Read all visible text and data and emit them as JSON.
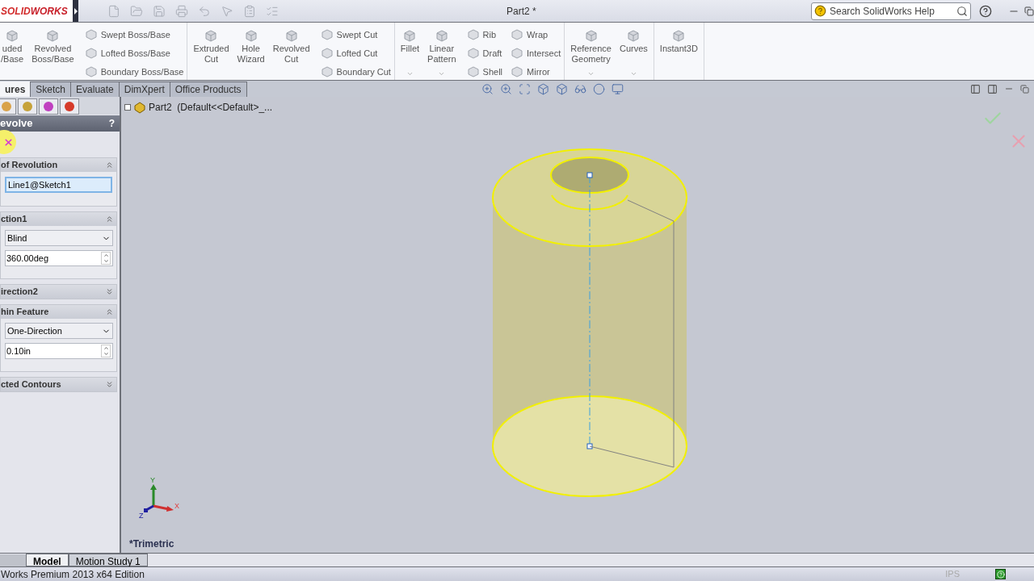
{
  "title_bar": {
    "logo": {
      "first": "SOLID",
      "second": "WORKS"
    },
    "title": "Part2 *",
    "search": {
      "placeholder": "Search SolidWorks Help"
    }
  },
  "ribbon": {
    "groups": [
      {
        "large": [
          {
            "lines": [
              "uded",
              "/Base"
            ]
          },
          {
            "lines": [
              "Revolved",
              "Boss/Base"
            ]
          }
        ],
        "small": [
          [
            "Swept Boss/Base",
            "Lofted Boss/Base",
            "Boundary Boss/Base"
          ]
        ]
      },
      {
        "large": [
          {
            "lines": [
              "Extruded",
              "Cut"
            ]
          },
          {
            "lines": [
              "Hole",
              "Wizard"
            ]
          },
          {
            "lines": [
              "Revolved",
              "Cut"
            ]
          }
        ],
        "small": [
          [
            "Swept Cut",
            "Lofted Cut",
            "Boundary Cut"
          ]
        ]
      },
      {
        "large": [
          {
            "lines": [
              "Fillet"
            ],
            "dropdown": true
          },
          {
            "lines": [
              "Linear",
              "Pattern"
            ],
            "dropdown": true
          }
        ],
        "small": [
          [
            "Rib",
            "Draft",
            "Shell"
          ],
          [
            "Wrap",
            "Intersect",
            "Mirror"
          ]
        ]
      },
      {
        "large": [
          {
            "lines": [
              "Reference",
              "Geometry"
            ],
            "dropdown": true
          },
          {
            "lines": [
              "Curves"
            ],
            "dropdown": true
          }
        ]
      },
      {
        "large": [
          {
            "lines": [
              "Instant3D"
            ]
          }
        ]
      }
    ]
  },
  "command_tabs": [
    {
      "label": "ures",
      "selected": true
    },
    {
      "label": "Sketch",
      "selected": false
    },
    {
      "label": "Evaluate",
      "selected": false
    },
    {
      "label": "DimXpert",
      "selected": false
    },
    {
      "label": "Office Products",
      "selected": false
    }
  ],
  "property_manager": {
    "title": "evolve",
    "help": "?",
    "sections": [
      {
        "title": "of Revolution",
        "expanded": true,
        "fields": [
          {
            "kind": "selection",
            "value": "Line1@Sketch1",
            "active": true
          }
        ]
      },
      {
        "title": "ction1",
        "expanded": true,
        "fields": [
          {
            "kind": "dropdown",
            "value": "Blind"
          },
          {
            "kind": "spinner",
            "value": "360.00deg"
          }
        ]
      },
      {
        "title": "irection2",
        "expanded": false
      },
      {
        "title": "hin Feature",
        "expanded": true,
        "fields": [
          {
            "kind": "dropdown",
            "value": "One-Direction"
          },
          {
            "kind": "spinner",
            "value": "0.10in"
          }
        ]
      },
      {
        "title": "cted Contours",
        "expanded": false
      }
    ]
  },
  "viewport": {
    "tree_item": "Part2  (Default<<Default>_...",
    "triad": {
      "x": "X",
      "y": "Y",
      "z": "Z"
    },
    "view_name": "*Trimetric"
  },
  "bottom_tabs": [
    {
      "label": "Model",
      "selected": true
    },
    {
      "label": "Motion Study 1",
      "selected": false
    }
  ],
  "status_bar": {
    "text": "Works Premium 2013 x64 Edition",
    "units": "IPS"
  }
}
